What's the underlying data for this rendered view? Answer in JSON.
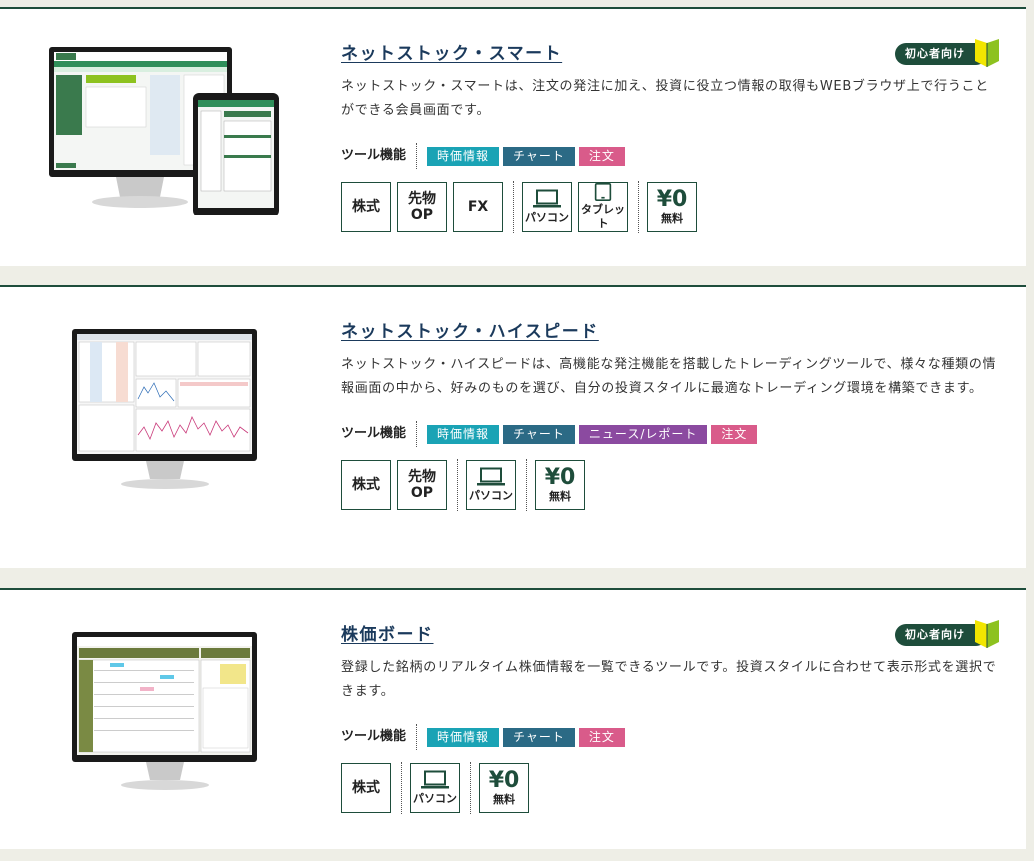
{
  "feature_label": "ツール機能",
  "badge_label": "初心者向け",
  "tools": [
    {
      "title": "ネットストック・スマート",
      "description": "ネットストック・スマートは、注文の発注に加え、投資に役立つ情報の取得もWEBブラウザ上で行うことができる会員画面です。",
      "tags": [
        "時価情報",
        "チャート",
        "注文"
      ],
      "products": [
        "株式",
        "先物OP",
        "FX"
      ],
      "devices": [
        "パソコン",
        "タブレット"
      ],
      "price": "¥0",
      "price_note": "無料"
    },
    {
      "title": "ネットストック・ハイスピード",
      "description": "ネットストック・ハイスピードは、高機能な発注機能を搭載したトレーディングツールで、様々な種類の情報画面の中から、好みのものを選び、自分の投資スタイルに最適なトレーディング環境を構築できます。",
      "tags": [
        "時価情報",
        "チャート",
        "ニュース/レポート",
        "注文"
      ],
      "products": [
        "株式",
        "先物OP"
      ],
      "devices": [
        "パソコン"
      ],
      "price": "¥0",
      "price_note": "無料"
    },
    {
      "title": "株価ボード",
      "description": "登録した銘柄のリアルタイム株価情報を一覧できるツールです。投資スタイルに合わせて表示形式を選択できます。",
      "tags": [
        "時価情報",
        "チャート",
        "注文"
      ],
      "products": [
        "株式"
      ],
      "devices": [
        "パソコン"
      ],
      "price": "¥0",
      "price_note": "無料"
    }
  ],
  "product_parts": {
    "futures_line1": "先物",
    "futures_line2": "OP"
  },
  "colors": {
    "brand_green": "#1e4d3b",
    "tag_jika": "#1aa3b5",
    "tag_chart": "#2b6a85",
    "tag_news": "#8b4aa0",
    "tag_order": "#d95b8a",
    "leaf_green": "#8dc21f",
    "leaf_yellow": "#f2e600"
  }
}
